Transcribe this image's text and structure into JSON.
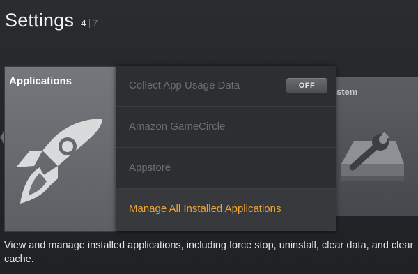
{
  "header": {
    "title": "Settings",
    "page_current": "4",
    "page_total": "7"
  },
  "cards": {
    "selected": {
      "title": "Applications",
      "icon": "rocket-icon"
    },
    "next": {
      "title": "stem",
      "icon": "wrench-drive-icon"
    }
  },
  "menu": {
    "items": [
      {
        "label": "Collect App Usage Data",
        "toggle": "OFF"
      },
      {
        "label": "Amazon GameCircle"
      },
      {
        "label": "Appstore"
      },
      {
        "label": "Manage All Installed Applications"
      }
    ]
  },
  "description": "View and manage installed applications, including force stop, uninstall, clear data, and clear cache.",
  "colors": {
    "accent": "#f0a531",
    "dim_text": "#6b6e72",
    "panel": "#2c2e31"
  }
}
